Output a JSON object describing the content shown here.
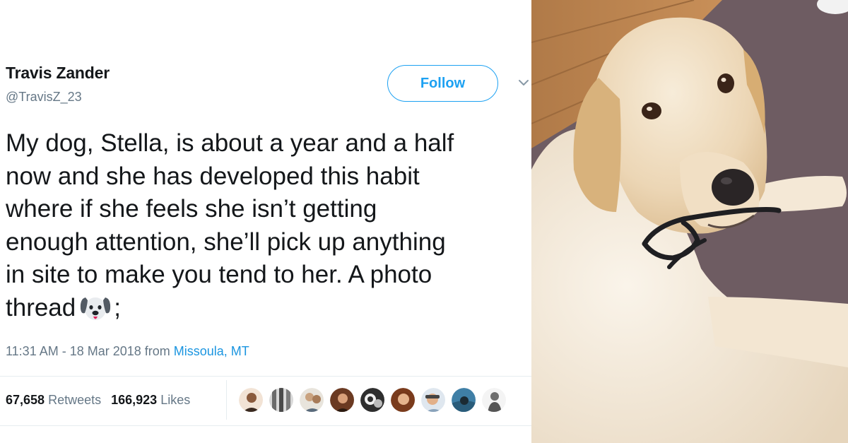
{
  "tweet": {
    "display_name": "Travis Zander",
    "handle": "@TravisZ_23",
    "follow_label": "Follow",
    "text_lines": [
      "My dog, Stella, is about a year and a half",
      "now and she has developed this habit",
      "where if she feels she isn’t getting",
      "enough attention, she’ll pick up anything",
      "in site to make you tend to her. A photo"
    ],
    "text_last_prefix": "thread",
    "text_last_suffix": ";",
    "emoji": "dog-face-icon",
    "timestamp": "11:31 AM - 18 Mar 2018 from ",
    "location": "Missoula, MT",
    "retweets_count": "67,658",
    "retweets_label": "Retweets",
    "likes_count": "166,923",
    "likes_label": "Likes"
  },
  "colors": {
    "accent": "#1da1f2",
    "link": "#1b95e0",
    "text": "#14171a",
    "muted": "#657786"
  },
  "avatars": [
    "avatar-1",
    "avatar-2",
    "avatar-3",
    "avatar-4",
    "avatar-5",
    "avatar-6",
    "avatar-7",
    "avatar-8",
    "avatar-9"
  ]
}
